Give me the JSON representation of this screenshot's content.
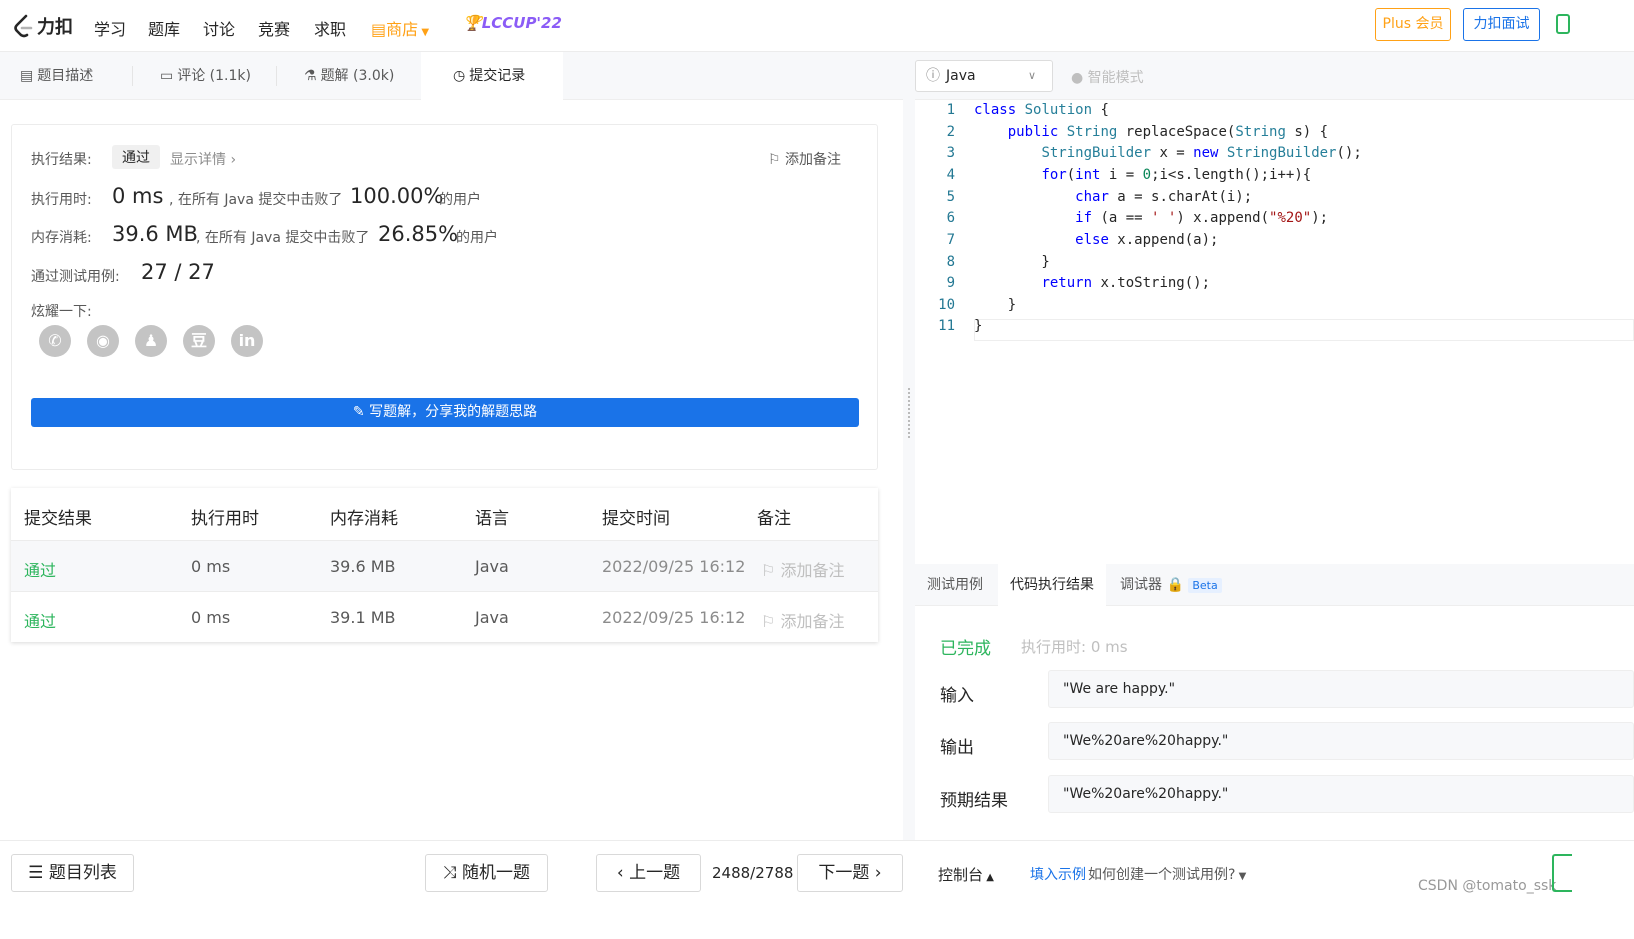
{
  "nav": {
    "logo_text": "力扣",
    "items": [
      "学习",
      "题库",
      "讨论",
      "竞赛",
      "求职"
    ],
    "store": "商店",
    "contest_badge": "LCCUP'22",
    "plus": "Plus 会员",
    "interview": "力扣面试"
  },
  "tabs": [
    {
      "label": "题目描述",
      "icon": "document-icon"
    },
    {
      "label": "评论 (1.1k)",
      "icon": "comment-icon"
    },
    {
      "label": "题解 (3.0k)",
      "icon": "flask-icon"
    },
    {
      "label": "提交记录",
      "icon": "clock-icon"
    }
  ],
  "result": {
    "status_label": "执行结果:",
    "status": "通过",
    "details": "显示详情",
    "add_note": "添加备注",
    "runtime_label": "执行用时:",
    "runtime_value": "0 ms",
    "runtime_text": ", 在所有 Java 提交中击败了",
    "runtime_pct": "100.00%",
    "users": "的用户",
    "memory_label": "内存消耗:",
    "memory_value": "39.6 MB",
    "memory_text": ", 在所有 Java 提交中击败了",
    "memory_pct": "26.85%",
    "tests_label": "通过测试用例:",
    "tests_value": "27 / 27",
    "share_label": "炫耀一下:",
    "write_button": "写题解，分享我的解题思路"
  },
  "submissions": {
    "headers": [
      "提交结果",
      "执行用时",
      "内存消耗",
      "语言",
      "提交时间",
      "备注"
    ],
    "rows": [
      {
        "result": "通过",
        "time": "0 ms",
        "memory": "39.6 MB",
        "lang": "Java",
        "submitted": "2022/09/25 16:12",
        "note": "添加备注"
      },
      {
        "result": "通过",
        "time": "0 ms",
        "memory": "39.1 MB",
        "lang": "Java",
        "submitted": "2022/09/25 16:12",
        "note": "添加备注"
      }
    ]
  },
  "editor": {
    "language": "Java",
    "smart_mode": "智能模式",
    "lines": [
      "1",
      "2",
      "3",
      "4",
      "5",
      "6",
      "7",
      "8",
      "9",
      "10",
      "11"
    ]
  },
  "console": {
    "tabs": [
      "测试用例",
      "代码执行结果",
      "调试器"
    ],
    "beta": "Beta",
    "status": "已完成",
    "runtime": "执行用时: 0 ms",
    "input_label": "输入",
    "input_value": "\"We are happy.\"",
    "output_label": "输出",
    "output_value": "\"We%20are%20happy.\"",
    "expected_label": "预期结果",
    "expected_value": "\"We%20are%20happy.\""
  },
  "bottom": {
    "problem_list": "题目列表",
    "random": "随机一题",
    "prev": "上一题",
    "counter": "2488/2788",
    "next": "下一题",
    "console": "控制台",
    "fill_example": "填入示例",
    "how_to": "如何创建一个测试用例?",
    "watermark": "CSDN @tomato_ssk"
  },
  "colors": {
    "accent": "#1a73e8",
    "pass": "#2db55d",
    "plus": "#ffa116"
  }
}
